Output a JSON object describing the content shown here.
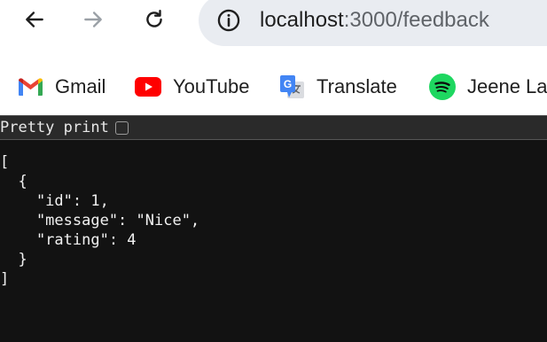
{
  "browser": {
    "url_host": "localhost",
    "url_path": ":3000/feedback"
  },
  "bookmarks": [
    {
      "label": "Gmail",
      "icon": "gmail-icon"
    },
    {
      "label": "YouTube",
      "icon": "youtube-icon"
    },
    {
      "label": "Translate",
      "icon": "translate-icon"
    },
    {
      "label": "Jeene La",
      "icon": "spotify-icon"
    }
  ],
  "viewer": {
    "pretty_print_label": "Pretty print",
    "pretty_print_checked": false,
    "json_text": "[\n  {\n    \"id\": 1,\n    \"message\": \"Nice\",\n    \"rating\": 4\n  }\n]"
  },
  "colors": {
    "page_bg": "#121212",
    "youtube_red": "#ff0000",
    "spotify_green": "#1ed760"
  }
}
